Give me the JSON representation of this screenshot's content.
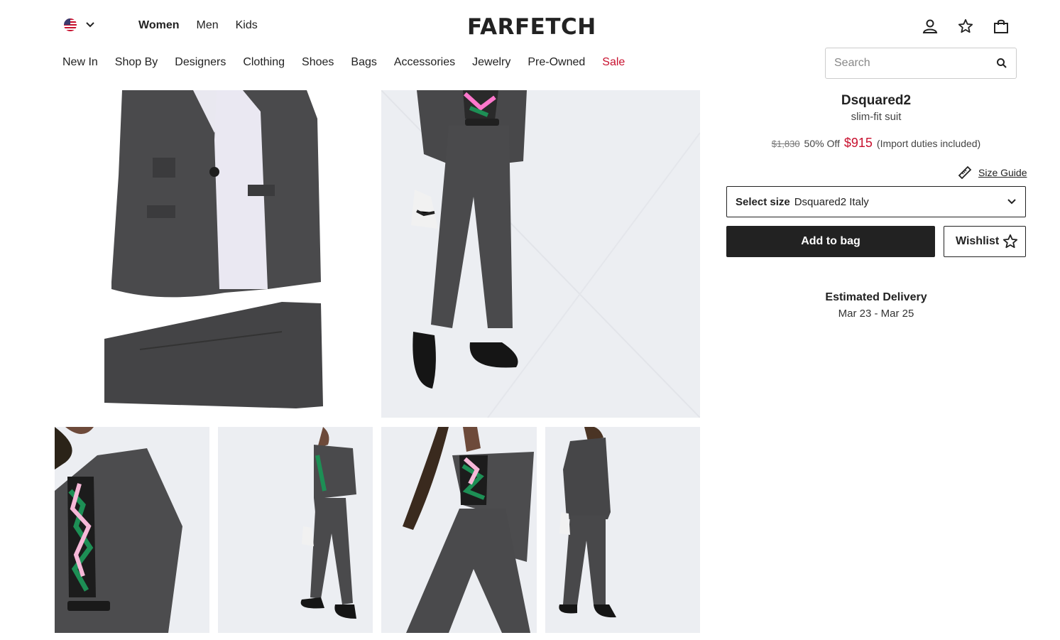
{
  "header": {
    "country_icon": "us-flag-icon",
    "gender_tabs": [
      "Women",
      "Men",
      "Kids"
    ],
    "active_gender": "Women",
    "logo": "FARFETCH",
    "icons": [
      "account-icon",
      "wishlist-star-icon",
      "shopping-bag-icon"
    ]
  },
  "nav": {
    "items": [
      "New In",
      "Shop By",
      "Designers",
      "Clothing",
      "Shoes",
      "Bags",
      "Accessories",
      "Jewelry",
      "Pre-Owned",
      "Sale"
    ],
    "sale_color": "#c8102e"
  },
  "search": {
    "placeholder": "Search"
  },
  "product": {
    "brand": "Dsquared2",
    "name": "slim-fit suit",
    "price_original": "$1,830",
    "discount": "50% Off",
    "price_sale": "$915",
    "duties_note": "(Import duties included)",
    "size_guide": "Size Guide",
    "select_size_label": "Select size",
    "select_size_value": "Dsquared2 Italy",
    "add_to_bag": "Add to bag",
    "wishlist": "Wishlist",
    "delivery_title": "Estimated Delivery",
    "delivery_dates": "Mar 23 - Mar 25"
  },
  "colors": {
    "accent": "#c8102e",
    "button_dark": "#222222"
  }
}
